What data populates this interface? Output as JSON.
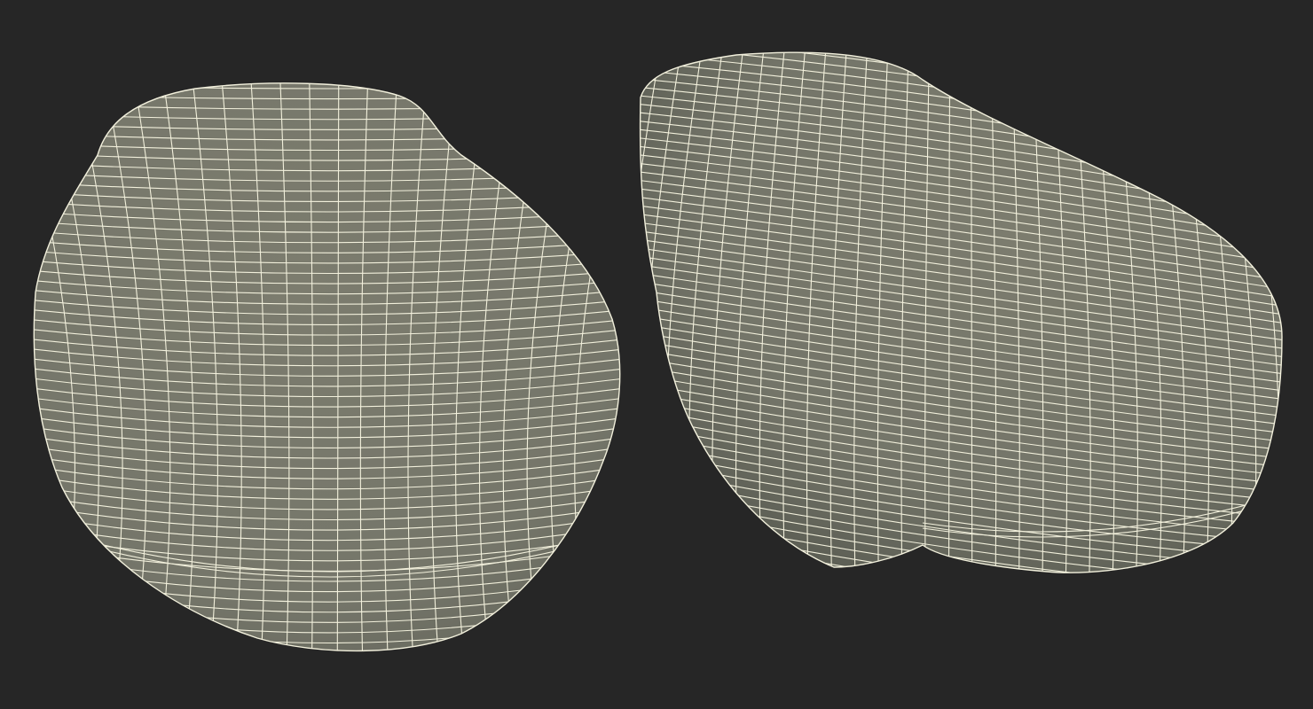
{
  "scene": {
    "background_color": "#262626",
    "mesh_fill_color": "#7a7a6c",
    "mesh_shadow_color": "#5f6156",
    "wireframe_color": "#f2f0dc",
    "objects": [
      {
        "name": "wireframe-mesh-front-view",
        "shape": "rounded kidney-shaped pad",
        "view": "front"
      },
      {
        "name": "wireframe-mesh-angled-view",
        "shape": "rounded oblong pad",
        "view": "three-quarter"
      }
    ]
  }
}
